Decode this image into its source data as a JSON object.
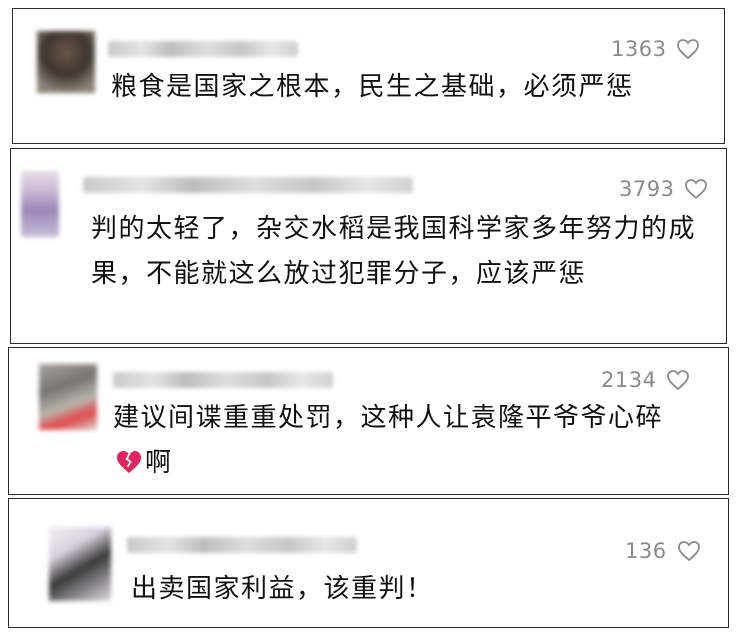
{
  "comments": [
    {
      "likes": "1363",
      "text": "粮食是国家之根本，民生之基础，必须严惩",
      "heart_icon": "heart-outline-icon"
    },
    {
      "likes": "3793",
      "text": "判的太轻了，杂交水稻是我国科学家多年努力的成果，不能就这么放过犯罪分子，应该严惩",
      "heart_icon": "heart-outline-icon"
    },
    {
      "likes": "2134",
      "text_part1": "建议间谍重重处罚，这种人让袁隆平爷爷心碎",
      "emoji": "broken-heart-icon",
      "text_part2": "啊",
      "heart_icon": "heart-outline-icon"
    },
    {
      "likes": "136",
      "text": "出卖国家利益，该重判！",
      "heart_icon": "heart-outline-icon"
    }
  ],
  "colors": {
    "text": "#111111",
    "likes": "#8a8a8a",
    "border": "#2a2a2a",
    "broken_heart": "#e0245e"
  }
}
